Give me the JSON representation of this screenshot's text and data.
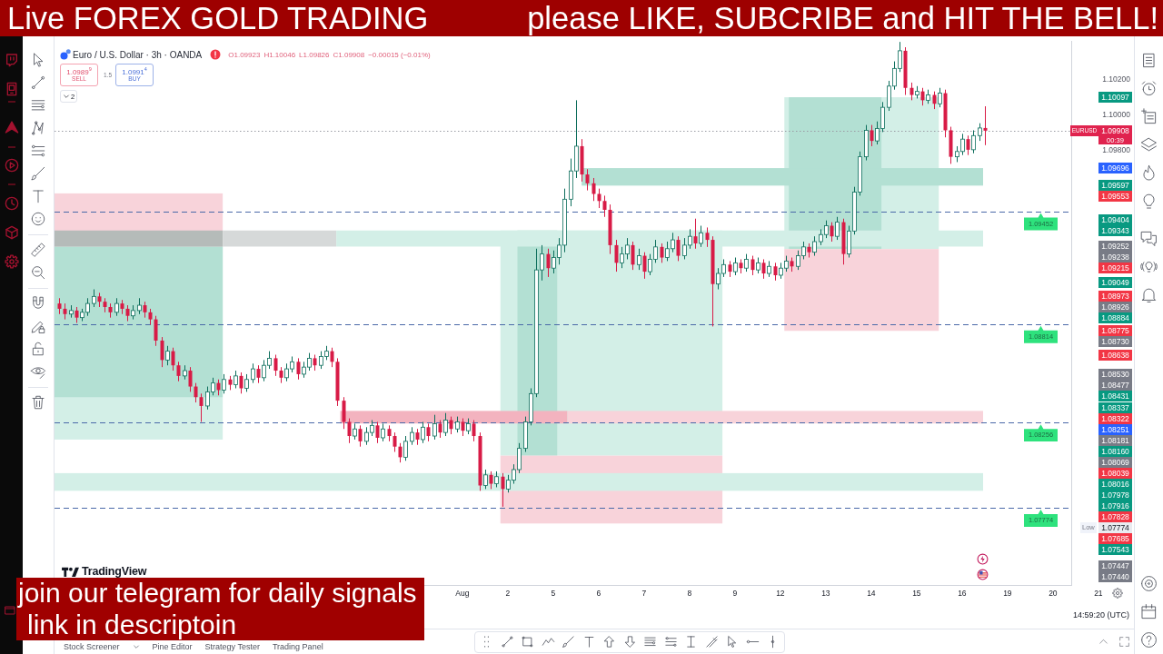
{
  "stream_banner": {
    "left": "Live FOREX GOLD TRADING",
    "right": "please LIKE, SUBCRIBE and HIT THE BELL!"
  },
  "symbol": {
    "title": "Euro / U.S. Dollar · 3h · OANDA",
    "ohlc": [
      "O1.09923",
      "H1.10046",
      "L1.09826",
      "C1.09908",
      "−0.00015 (−0.01%)"
    ]
  },
  "trade": {
    "sell_price": "1.0989$^{9}$",
    "sell_label": "SELL",
    "spread": "1.5",
    "buy_price": "1.0991$^{4}$",
    "buy_label": "BUY"
  },
  "indicators_button": "2",
  "chart_data": [
    {
      "type": "candlestick",
      "ylim": [
        1.07332,
        1.10416
      ],
      "yticks": [
        {
          "value": 1.098,
          "label": "1.09800"
        },
        {
          "value": 1.1,
          "label": "1.10000"
        },
        {
          "value": 1.102,
          "label": "1.10200"
        }
      ],
      "categories": [
        null,
        null,
        null,
        null,
        null,
        null,
        null,
        null,
        null,
        null,
        null,
        null,
        null,
        null,
        null,
        null,
        null,
        null,
        null,
        null,
        null,
        null,
        null,
        null,
        null,
        null,
        null,
        null,
        null,
        null,
        null,
        null,
        null,
        null,
        null,
        null,
        null,
        null,
        null,
        null,
        null,
        null,
        null,
        null,
        null,
        null,
        null,
        null,
        null,
        null,
        null,
        null,
        null,
        null,
        null,
        null,
        null,
        null,
        null,
        null,
        null,
        null,
        null,
        null,
        null,
        null,
        null,
        null,
        null,
        null,
        null,
        "Aug",
        null,
        null,
        null,
        null,
        null,
        null,
        null,
        "2",
        null,
        null,
        null,
        null,
        null,
        null,
        null,
        "5",
        null,
        null,
        null,
        null,
        null,
        null,
        null,
        "6",
        null,
        null,
        null,
        null,
        null,
        null,
        null,
        "7",
        null,
        null,
        null,
        null,
        null,
        null,
        null,
        "8",
        null,
        null,
        null,
        null,
        null,
        null,
        null,
        "9",
        null,
        null,
        null,
        null,
        null,
        null,
        null,
        "12",
        null,
        null,
        null,
        null,
        null,
        null,
        null,
        "13",
        null,
        null,
        null,
        null,
        null,
        null,
        null,
        "14",
        null,
        null,
        null,
        null,
        null,
        null,
        null,
        "15",
        null,
        null,
        null,
        null,
        null,
        null,
        null,
        "16",
        null,
        null,
        null,
        null,
        null,
        null,
        null,
        "19",
        null,
        null,
        null,
        null,
        null,
        null,
        null,
        "20",
        null,
        null,
        null,
        null,
        null,
        null,
        null,
        "21",
        null
      ],
      "ohlc": [
        [
          1.0893,
          1.0896,
          1.0887,
          1.089
        ],
        [
          1.089,
          1.0893,
          1.0884,
          1.0887
        ],
        [
          1.0887,
          1.0892,
          1.0885,
          1.0889
        ],
        [
          1.0889,
          1.0891,
          1.0882,
          1.0885
        ],
        [
          1.0885,
          1.089,
          1.0883,
          1.0888
        ],
        [
          1.0888,
          1.0896,
          1.0886,
          1.0893
        ],
        [
          1.0893,
          1.0901,
          1.0891,
          1.0897
        ],
        [
          1.0897,
          1.0899,
          1.0891,
          1.0894
        ],
        [
          1.0894,
          1.0896,
          1.0888,
          1.0891
        ],
        [
          1.0891,
          1.0893,
          1.0885,
          1.0888
        ],
        [
          1.0888,
          1.0896,
          1.0886,
          1.0893
        ],
        [
          1.0893,
          1.0895,
          1.0887,
          1.089
        ],
        [
          1.089,
          1.0892,
          1.0883,
          1.0886
        ],
        [
          1.0886,
          1.0892,
          1.0884,
          1.0889
        ],
        [
          1.0889,
          1.0896,
          1.0887,
          1.0892
        ],
        [
          1.0892,
          1.0894,
          1.0885,
          1.0888
        ],
        [
          1.0888,
          1.089,
          1.0881,
          1.0884
        ],
        [
          1.0884,
          1.0886,
          1.0869,
          1.0872
        ],
        [
          1.0872,
          1.0874,
          1.0857,
          1.0861
        ],
        [
          1.0861,
          1.0869,
          1.0858,
          1.0866
        ],
        [
          1.0866,
          1.0868,
          1.0855,
          1.0858
        ],
        [
          1.0858,
          1.086,
          1.0849,
          1.0852
        ],
        [
          1.0852,
          1.0858,
          1.085,
          1.0855
        ],
        [
          1.0855,
          1.0857,
          1.0843,
          1.0846
        ],
        [
          1.0846,
          1.0848,
          1.0837,
          1.084
        ],
        [
          1.084,
          1.0842,
          1.0826,
          1.0835
        ],
        [
          1.0835,
          1.0846,
          1.0833,
          1.0843
        ],
        [
          1.0843,
          1.0851,
          1.0841,
          1.0848
        ],
        [
          1.0848,
          1.085,
          1.0841,
          1.0844
        ],
        [
          1.0844,
          1.0853,
          1.0842,
          1.085
        ],
        [
          1.085,
          1.0852,
          1.0844,
          1.0847
        ],
        [
          1.0847,
          1.0855,
          1.0845,
          1.0852
        ],
        [
          1.0852,
          1.0854,
          1.0842,
          1.0845
        ],
        [
          1.0845,
          1.0853,
          1.0843,
          1.085
        ],
        [
          1.085,
          1.0859,
          1.0848,
          1.0856
        ],
        [
          1.0856,
          1.0858,
          1.0848,
          1.0851
        ],
        [
          1.0851,
          1.0861,
          1.0849,
          1.0858
        ],
        [
          1.0858,
          1.0866,
          1.0856,
          1.0862
        ],
        [
          1.0862,
          1.0864,
          1.0852,
          1.0855
        ],
        [
          1.0855,
          1.0857,
          1.0848,
          1.0851
        ],
        [
          1.0851,
          1.0859,
          1.0849,
          1.0856
        ],
        [
          1.0856,
          1.0863,
          1.0854,
          1.086
        ],
        [
          1.086,
          1.0862,
          1.085,
          1.0853
        ],
        [
          1.0853,
          1.086,
          1.0851,
          1.0857
        ],
        [
          1.0857,
          1.0865,
          1.0855,
          1.0862
        ],
        [
          1.0862,
          1.0864,
          1.0855,
          1.0858
        ],
        [
          1.0858,
          1.0866,
          1.0856,
          1.0863
        ],
        [
          1.0863,
          1.0869,
          1.0861,
          1.0866
        ],
        [
          1.0866,
          1.0868,
          1.0857,
          1.086
        ],
        [
          1.086,
          1.0862,
          1.0835,
          1.0838
        ],
        [
          1.0838,
          1.084,
          1.0822,
          1.0826
        ],
        [
          1.0826,
          1.0828,
          1.0814,
          1.0818
        ],
        [
          1.0818,
          1.0825,
          1.0816,
          1.0822
        ],
        [
          1.0822,
          1.0824,
          1.0812,
          1.0815
        ],
        [
          1.0815,
          1.0823,
          1.0813,
          1.082
        ],
        [
          1.082,
          1.0827,
          1.0818,
          1.0824
        ],
        [
          1.0824,
          1.0826,
          1.0814,
          1.0817
        ],
        [
          1.0817,
          1.0825,
          1.0815,
          1.0822
        ],
        [
          1.0822,
          1.0824,
          1.0815,
          1.0818
        ],
        [
          1.0818,
          1.082,
          1.0809,
          1.0812
        ],
        [
          1.0812,
          1.0814,
          1.0803,
          1.0806
        ],
        [
          1.0806,
          1.0818,
          1.0804,
          1.0815
        ],
        [
          1.0815,
          1.0823,
          1.0813,
          1.082
        ],
        [
          1.082,
          1.0822,
          1.0813,
          1.0816
        ],
        [
          1.0816,
          1.0826,
          1.0814,
          1.0823
        ],
        [
          1.0823,
          1.0825,
          1.0815,
          1.0818
        ],
        [
          1.0818,
          1.083,
          1.0816,
          1.0825
        ],
        [
          1.0825,
          1.0827,
          1.0817,
          1.082
        ],
        [
          1.082,
          1.0831,
          1.0818,
          1.0827
        ],
        [
          1.0827,
          1.0829,
          1.0819,
          1.0822
        ],
        [
          1.0822,
          1.0829,
          1.082,
          1.0826
        ],
        [
          1.0826,
          1.0828,
          1.0818,
          1.0821
        ],
        [
          1.0821,
          1.0828,
          1.0819,
          1.0825
        ],
        [
          1.0825,
          1.0827,
          1.0815,
          1.0818
        ],
        [
          1.0818,
          1.082,
          1.0787,
          1.079
        ],
        [
          1.079,
          1.0799,
          1.0788,
          1.0796
        ],
        [
          1.0796,
          1.0798,
          1.0788,
          1.0791
        ],
        [
          1.0791,
          1.0798,
          1.0789,
          1.0795
        ],
        [
          1.0795,
          1.0797,
          1.0778,
          1.0788
        ],
        [
          1.0788,
          1.0796,
          1.0786,
          1.0793
        ],
        [
          1.0793,
          1.0802,
          1.0791,
          1.0799
        ],
        [
          1.0799,
          1.0814,
          1.0797,
          1.0811
        ],
        [
          1.0811,
          1.0829,
          1.0809,
          1.0826
        ],
        [
          1.0826,
          1.0845,
          1.0824,
          1.0842
        ],
        [
          1.0842,
          1.0924,
          1.084,
          1.0912
        ],
        [
          1.0912,
          1.0926,
          1.0906,
          1.0921
        ],
        [
          1.0921,
          1.0924,
          1.0908,
          1.0913
        ],
        [
          1.0913,
          1.0923,
          1.091,
          1.0919
        ],
        [
          1.0919,
          1.093,
          1.0915,
          1.0926
        ],
        [
          1.0926,
          1.0958,
          1.0922,
          1.0952
        ],
        [
          1.0952,
          1.0975,
          1.0948,
          1.0968
        ],
        [
          1.0968,
          1.1008,
          1.0964,
          1.0982
        ],
        [
          1.0982,
          1.0986,
          1.0962,
          1.0966
        ],
        [
          1.0966,
          1.0969,
          1.0957,
          1.0961
        ],
        [
          1.0961,
          1.0964,
          1.0951,
          1.0955
        ],
        [
          1.0955,
          1.0958,
          1.0947,
          1.0951
        ],
        [
          1.0951,
          1.0954,
          1.0942,
          1.0946
        ],
        [
          1.0946,
          1.0949,
          1.0921,
          1.0926
        ],
        [
          1.0926,
          1.0929,
          1.0911,
          1.0916
        ],
        [
          1.0916,
          1.0925,
          1.0913,
          1.0921
        ],
        [
          1.0921,
          1.093,
          1.0918,
          1.0926
        ],
        [
          1.0926,
          1.0928,
          1.0912,
          1.0915
        ],
        [
          1.0915,
          1.0924,
          1.0912,
          1.092
        ],
        [
          1.092,
          1.0922,
          1.0907,
          1.0911
        ],
        [
          1.0911,
          1.0921,
          1.0909,
          1.0918
        ],
        [
          1.0918,
          1.0929,
          1.0916,
          1.0925
        ],
        [
          1.0925,
          1.0927,
          1.0916,
          1.0919
        ],
        [
          1.0919,
          1.0928,
          1.0917,
          1.0924
        ],
        [
          1.0924,
          1.0933,
          1.0922,
          1.0929
        ],
        [
          1.0929,
          1.0931,
          1.0917,
          1.092
        ],
        [
          1.092,
          1.093,
          1.0918,
          1.0926
        ],
        [
          1.0926,
          1.0935,
          1.0924,
          1.0931
        ],
        [
          1.0931,
          1.0941,
          1.0924,
          1.0927
        ],
        [
          1.0927,
          1.0937,
          1.0925,
          1.0933
        ],
        [
          1.0933,
          1.0936,
          1.0925,
          1.0929
        ],
        [
          1.0929,
          1.0931,
          1.088,
          1.0904
        ],
        [
          1.0904,
          1.0913,
          1.0901,
          1.091
        ],
        [
          1.091,
          1.0918,
          1.0908,
          1.0915
        ],
        [
          1.0915,
          1.0917,
          1.0908,
          1.0911
        ],
        [
          1.0911,
          1.0919,
          1.0909,
          1.0916
        ],
        [
          1.0916,
          1.0918,
          1.091,
          1.0913
        ],
        [
          1.0913,
          1.0921,
          1.0911,
          1.0918
        ],
        [
          1.0918,
          1.092,
          1.0909,
          1.0912
        ],
        [
          1.0912,
          1.0919,
          1.091,
          1.0916
        ],
        [
          1.0916,
          1.0918,
          1.0907,
          1.091
        ],
        [
          1.091,
          1.0917,
          1.0908,
          1.0914
        ],
        [
          1.0914,
          1.0916,
          1.0906,
          1.0909
        ],
        [
          1.0909,
          1.0916,
          1.0907,
          1.0913
        ],
        [
          1.0913,
          1.092,
          1.0911,
          1.0917
        ],
        [
          1.0917,
          1.0919,
          1.0911,
          1.0914
        ],
        [
          1.0914,
          1.0923,
          1.0912,
          1.092
        ],
        [
          1.092,
          1.0928,
          1.0918,
          1.0925
        ],
        [
          1.0925,
          1.0927,
          1.0919,
          1.0922
        ],
        [
          1.0922,
          1.0931,
          1.092,
          1.0928
        ],
        [
          1.0928,
          1.0935,
          1.0926,
          1.0932
        ],
        [
          1.0932,
          1.094,
          1.093,
          1.0937
        ],
        [
          1.0937,
          1.0939,
          1.0928,
          1.0931
        ],
        [
          1.0931,
          1.0942,
          1.0929,
          1.0939
        ],
        [
          1.0939,
          1.0941,
          1.0915,
          1.0921
        ],
        [
          1.0921,
          1.0937,
          1.0919,
          1.0934
        ],
        [
          1.0934,
          1.0959,
          1.0932,
          1.0956
        ],
        [
          1.0956,
          1.0979,
          1.0954,
          1.0976
        ],
        [
          1.0976,
          1.0994,
          1.0974,
          1.0991
        ],
        [
          1.0991,
          1.0994,
          1.0982,
          1.0985
        ],
        [
          1.0985,
          1.0996,
          1.0983,
          1.0992
        ],
        [
          1.0992,
          1.1007,
          1.099,
          1.1004
        ],
        [
          1.1004,
          1.1019,
          1.1002,
          1.1016
        ],
        [
          1.1016,
          1.103,
          1.1014,
          1.1026
        ],
        [
          1.1026,
          1.1041,
          1.1024,
          1.1036
        ],
        [
          1.1036,
          1.1038,
          1.1011,
          1.1015
        ],
        [
          1.1015,
          1.1018,
          1.1008,
          1.1011
        ],
        [
          1.1011,
          1.1016,
          1.1009,
          1.1013
        ],
        [
          1.1013,
          1.1015,
          1.1005,
          1.1008
        ],
        [
          1.1008,
          1.1014,
          1.1006,
          1.1011
        ],
        [
          1.1011,
          1.1013,
          1.1003,
          1.1006
        ],
        [
          1.1006,
          1.1015,
          1.1004,
          1.1012
        ],
        [
          1.1012,
          1.1014,
          1.0987,
          1.0991
        ],
        [
          1.0991,
          1.0993,
          1.0972,
          1.0976
        ],
        [
          1.0976,
          1.0982,
          1.0973,
          1.0979
        ],
        [
          1.0979,
          1.0989,
          1.0977,
          1.0986
        ],
        [
          1.0986,
          1.0988,
          1.0977,
          1.098
        ],
        [
          1.098,
          1.0991,
          1.0978,
          1.0988
        ],
        [
          1.0988,
          1.0995,
          1.0985,
          1.09923
        ],
        [
          1.09923,
          1.10046,
          1.09826,
          1.09908
        ],
        null,
        null,
        null,
        null,
        null,
        null,
        null,
        null,
        null,
        null,
        null,
        null,
        null,
        null,
        null,
        null,
        null,
        null,
        null,
        null,
        null
      ],
      "ref_lines": [
        {
          "axis": "y",
          "value": 1.09908,
          "color": "#9a9ca4",
          "line_style": "dotted"
        },
        {
          "axis": "y",
          "value": 1.09452,
          "label": "1.09452",
          "color": "#4a69a8",
          "line_style": "dashed"
        },
        {
          "axis": "y",
          "value": 1.08814,
          "label": "1.08814",
          "color": "#4a69a8",
          "line_style": "dashed"
        },
        {
          "axis": "y",
          "value": 1.08256,
          "label": "1.08256",
          "color": "#4a69a8",
          "line_style": "dashed"
        },
        {
          "axis": "y",
          "value": 1.07774,
          "label": "1.07774",
          "color": "#4a69a8",
          "line_style": "dashed"
        }
      ]
    }
  ],
  "price_scale": {
    "symbol_tag": "EURUSD",
    "last_price": "1.09908",
    "countdown": "00:39",
    "labels": [
      {
        "kind": "line",
        "text": "1.10097",
        "color": "#089981"
      },
      {
        "kind": "line",
        "text": "1.09696",
        "color": "#2962ff"
      },
      {
        "kind": "line",
        "text": "1.09597",
        "color": "#089981"
      },
      {
        "kind": "line",
        "text": "1.09553",
        "color": "#f23645"
      },
      {
        "kind": "line",
        "text": "1.09404",
        "color": "#089981"
      },
      {
        "kind": "line",
        "text": "1.09343",
        "color": "#089981"
      },
      {
        "kind": "line",
        "text": "1.09252",
        "color": "#787b86"
      },
      {
        "kind": "line",
        "text": "1.09238",
        "color": "#787b86"
      },
      {
        "kind": "line",
        "text": "1.09215",
        "color": "#f23645"
      },
      {
        "kind": "line",
        "text": "1.09049",
        "color": "#089981"
      },
      {
        "kind": "line",
        "text": "1.08973",
        "color": "#f23645"
      },
      {
        "kind": "line",
        "text": "1.08926",
        "color": "#787b86"
      },
      {
        "kind": "line",
        "text": "1.08884",
        "color": "#089981"
      },
      {
        "kind": "line",
        "text": "1.08775",
        "color": "#f23645"
      },
      {
        "kind": "line",
        "text": "1.08730",
        "color": "#787b86"
      },
      {
        "kind": "line",
        "text": "1.08638",
        "color": "#f23645"
      },
      {
        "kind": "line",
        "text": "1.08530",
        "color": "#787b86"
      },
      {
        "kind": "line",
        "text": "1.08477",
        "color": "#787b86"
      },
      {
        "kind": "line",
        "text": "1.08431",
        "color": "#089981"
      },
      {
        "kind": "line",
        "text": "1.08337",
        "color": "#089981"
      },
      {
        "kind": "line",
        "text": "1.08322",
        "color": "#f23645"
      },
      {
        "kind": "line",
        "text": "1.08251",
        "color": "#2962ff"
      },
      {
        "kind": "line",
        "text": "1.08181",
        "color": "#787b86"
      },
      {
        "kind": "line",
        "text": "1.08160",
        "color": "#089981"
      },
      {
        "kind": "line",
        "text": "1.08069",
        "color": "#787b86"
      },
      {
        "kind": "line",
        "text": "1.08039",
        "color": "#f23645"
      },
      {
        "kind": "line",
        "text": "1.08016",
        "color": "#089981"
      },
      {
        "kind": "line",
        "text": "1.07978",
        "color": "#089981"
      },
      {
        "kind": "line",
        "text": "1.07916",
        "color": "#089981"
      },
      {
        "kind": "line",
        "text": "1.07828",
        "color": "#f23645"
      },
      {
        "kind": "low",
        "tag": "Low",
        "text": "1.07774"
      },
      {
        "kind": "line",
        "text": "1.07685",
        "color": "#f23645"
      },
      {
        "kind": "line",
        "text": "1.07543",
        "color": "#089981"
      },
      {
        "kind": "line",
        "text": "1.07447",
        "color": "#787b86"
      },
      {
        "kind": "line",
        "text": "1.07440",
        "color": "#787b86"
      }
    ]
  },
  "chart_logo": "TradingView",
  "status_bar": {
    "time": "14:59:20 (UTC)"
  },
  "bottom_tabs": [
    {
      "label": "Stock Screener",
      "dropdown": true
    },
    {
      "label": "Pine Editor",
      "dropdown": false
    },
    {
      "label": "Strategy Tester",
      "dropdown": false
    },
    {
      "label": "Trading Panel",
      "dropdown": false
    }
  ],
  "promo_banner": [
    "join our telegram for daily signals",
    "link in descriptoin"
  ]
}
